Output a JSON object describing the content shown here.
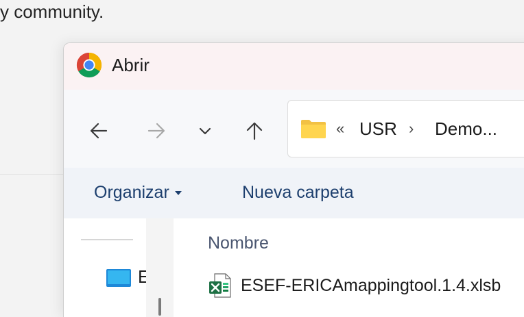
{
  "background": {
    "text": "y community."
  },
  "dialog": {
    "title": "Abrir",
    "nav": {
      "back_icon": "arrow-left-icon",
      "forward_icon": "arrow-right-icon",
      "recent_icon": "chevron-down-icon",
      "up_icon": "arrow-up-icon"
    },
    "address": {
      "overflow": "«",
      "crumbs": [
        "USR",
        "Demo..."
      ],
      "separator": "›"
    },
    "commands": {
      "organize": "Organizar",
      "new_folder": "Nueva carpeta"
    },
    "nav_pane": {
      "item_label": "E"
    },
    "file_list": {
      "column_name": "Nombre",
      "files": [
        {
          "name": "ESEF-ERICAmappingtool.1.4.xlsb",
          "icon": "excel-file-icon"
        }
      ]
    }
  }
}
